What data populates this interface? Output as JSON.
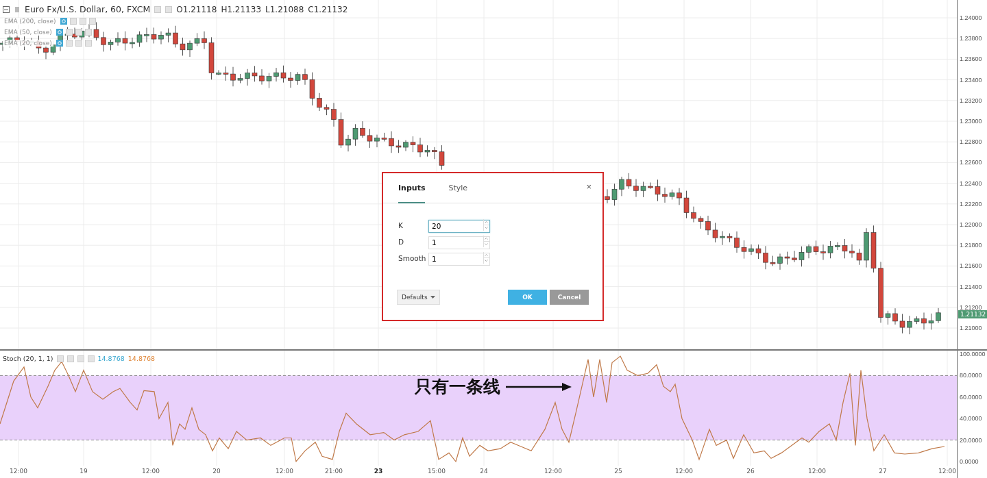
{
  "chart": {
    "symbol_title": "Euro Fx/U.S. Dollar, 60, FXCM",
    "ohlc": [
      "O1.21118",
      "H1.21133",
      "L1.21088",
      "C1.21132"
    ],
    "indicators": [
      {
        "label": "EMA (200, close)"
      },
      {
        "label": "EMA (50, close)"
      },
      {
        "label": "EMA (20, close)"
      }
    ],
    "price_axis": [
      "1.24000",
      "1.23800",
      "1.23600",
      "1.23400",
      "1.23200",
      "1.23000",
      "1.22800",
      "1.22600",
      "1.22400",
      "1.22200",
      "1.22000",
      "1.21800",
      "1.21600",
      "1.21400",
      "1.21200",
      "1.21000"
    ],
    "last_price": "1.21132"
  },
  "oscillator": {
    "label": "Stoch (20, 1, 1)",
    "values": [
      {
        "text": "14.8768",
        "color": "#3aa8d0"
      },
      {
        "text": "14.8768",
        "color": "#e0883a"
      }
    ],
    "axis": [
      "100.0000",
      "80.0000",
      "60.0000",
      "40.0000",
      "20.0000",
      "0.0000"
    ]
  },
  "time_axis": [
    {
      "label": "12:00",
      "bold": false
    },
    {
      "label": "19",
      "bold": false
    },
    {
      "label": "12:00",
      "bold": false
    },
    {
      "label": "20",
      "bold": false
    },
    {
      "label": "12:00",
      "bold": false
    },
    {
      "label": "21:00",
      "bold": false
    },
    {
      "label": "23",
      "bold": true
    },
    {
      "label": "15:00",
      "bold": false
    },
    {
      "label": "24",
      "bold": false
    },
    {
      "label": "12:00",
      "bold": false
    },
    {
      "label": "25",
      "bold": false
    },
    {
      "label": "12:00",
      "bold": false
    },
    {
      "label": "26",
      "bold": false
    },
    {
      "label": "12:00",
      "bold": false
    },
    {
      "label": "27",
      "bold": false
    },
    {
      "label": "12:00",
      "bold": false
    }
  ],
  "annotation": {
    "text": "只有一条线"
  },
  "dialog": {
    "tabs": [
      {
        "label": "Inputs",
        "selected": true
      },
      {
        "label": "Style",
        "selected": false
      }
    ],
    "close": "×",
    "fields": [
      {
        "label": "K",
        "value": "20",
        "focused": true
      },
      {
        "label": "D",
        "value": "1",
        "focused": false
      },
      {
        "label": "Smooth",
        "value": "1",
        "focused": false
      }
    ],
    "defaults_button": "Defaults",
    "ok_button": "OK",
    "cancel_button": "Cancel"
  }
}
